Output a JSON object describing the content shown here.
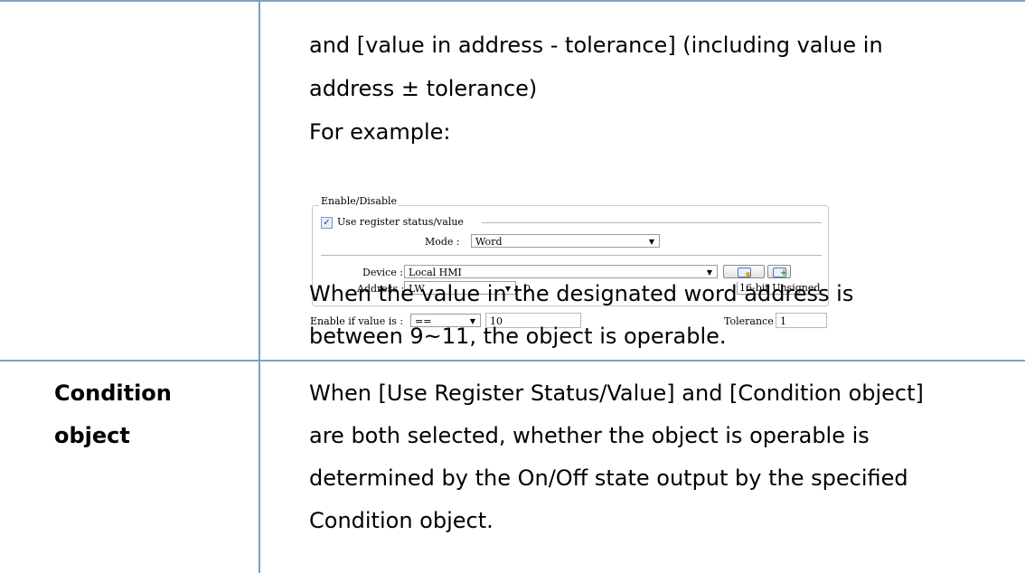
{
  "cell_top": {
    "line1": "and [value in address - tolerance] (including value in",
    "line2": "address ± tolerance)",
    "line3": "For example:",
    "line4": "When the value in the designated word address is",
    "line5": "between 9~11, the object is operable."
  },
  "dialog": {
    "group_title": "Enable/Disable",
    "checkbox_label": "Use register status/value",
    "checkbox_checked": true,
    "mode_label": "Mode :",
    "mode_value": "Word",
    "device_label": "Device :",
    "device_value": "Local HMI",
    "address_label": "Address :",
    "address_type": "LW",
    "address_value": "0",
    "data_format": "16-bit Unsigned",
    "enable_label": "Enable if value is :",
    "enable_operator": "==",
    "enable_value": "10",
    "tolerance_label": "Tolerance :",
    "tolerance_value": "1",
    "icons": [
      "tag-settings-icon",
      "add-tag-icon"
    ]
  },
  "row_condition": {
    "header_line1": "Condition",
    "header_line2": "object",
    "desc_line1": "When [Use Register Status/Value] and [Condition object]",
    "desc_line2": "are both selected, whether the object is operable is",
    "desc_line3": "determined by the On/Off state output by the specified",
    "desc_line4": "Condition object."
  },
  "colors": {
    "table_border": "#7f9fc6",
    "checkbox_accent": "#1b3e8c"
  }
}
